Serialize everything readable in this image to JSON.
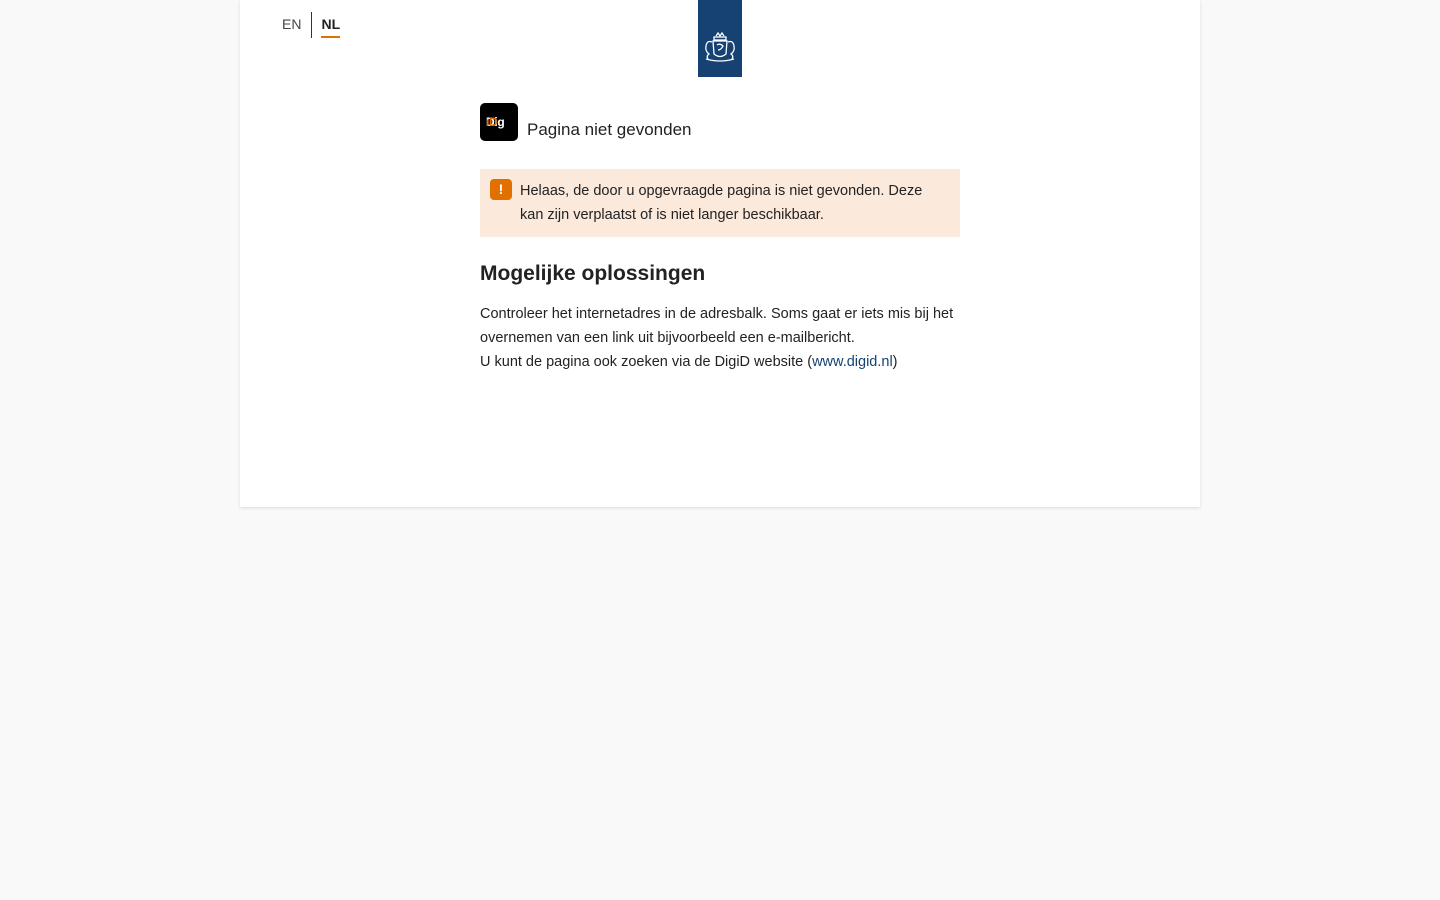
{
  "colors": {
    "brand_blue": "#154273",
    "accent_orange": "#e17000",
    "alert_bg": "#fbeadc",
    "page_bg": "#f9f9f9"
  },
  "language_switch": {
    "en_label": "EN",
    "nl_label": "NL",
    "active": "NL"
  },
  "header": {
    "crest_icon": "rijksoverheid-crest-icon"
  },
  "logo": {
    "text_main": "Dig",
    "text_accent": "iD"
  },
  "page_title": "Pagina niet gevonden",
  "alert": {
    "icon": "warning-icon",
    "icon_glyph": "!",
    "message": "Helaas, de door u opgevraagde pagina is niet gevonden. Deze kan zijn verplaatst of is niet langer beschikbaar."
  },
  "solutions": {
    "heading": "Mogelijke oplossingen",
    "paragraph_1": "Controleer het internetadres in de adresbalk. Soms gaat er iets mis bij het overnemen van een link uit bijvoorbeeld een e-mailbericht.",
    "paragraph_2_prefix": "U kunt de pagina ook zoeken via de DigiD website (",
    "link_text": "www.digid.nl",
    "paragraph_2_suffix": ")"
  }
}
